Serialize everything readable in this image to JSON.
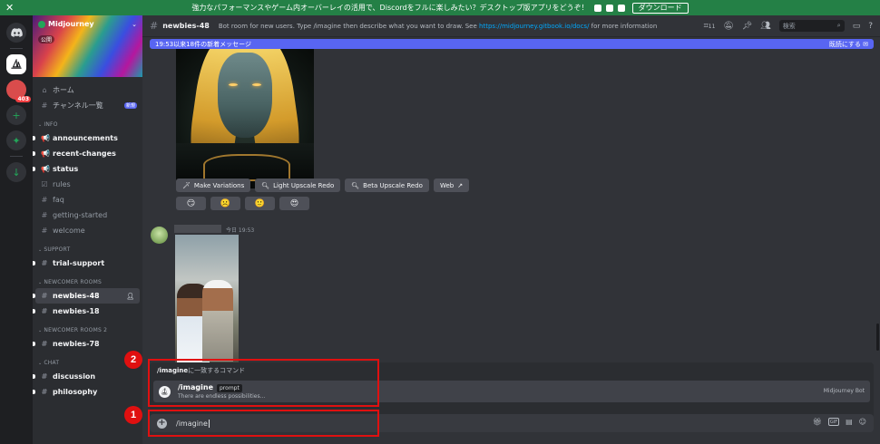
{
  "banner": {
    "text": "強力なパフォーマンスやゲーム内オーバーレイの活用で、Discordをフルに楽しみたい？デスクトップ版アプリをどうぞ！",
    "download_label": "ダウンロード",
    "close": "✕"
  },
  "servers": {
    "badge": "403",
    "add": "+",
    "discover": "✦",
    "download": "↓"
  },
  "server": {
    "name": "Midjourney",
    "public_label": "公開",
    "chevron": "⌄"
  },
  "channels": {
    "home": "ホーム",
    "browse": "チャンネル一覧",
    "new_tag": "新規",
    "categories": [
      {
        "name": "INFO",
        "items": [
          {
            "label": "announcements",
            "icon": "📢",
            "bold": true
          },
          {
            "label": "recent-changes",
            "icon": "📢",
            "bold": true
          },
          {
            "label": "status",
            "icon": "📢",
            "bold": true
          },
          {
            "label": "rules",
            "icon": "☑",
            "bold": false
          },
          {
            "label": "faq",
            "icon": "#",
            "bold": false
          },
          {
            "label": "getting-started",
            "icon": "#",
            "bold": false
          },
          {
            "label": "welcome",
            "icon": "#",
            "bold": false
          }
        ]
      },
      {
        "name": "SUPPORT",
        "items": [
          {
            "label": "trial-support",
            "icon": "#",
            "bold": true
          }
        ]
      },
      {
        "name": "NEWCOMER ROOMS",
        "items": [
          {
            "label": "newbies-48",
            "icon": "#",
            "bold": true,
            "active": true
          },
          {
            "label": "newbies-18",
            "icon": "#",
            "bold": true
          }
        ]
      },
      {
        "name": "NEWCOMER ROOMS 2",
        "items": [
          {
            "label": "newbies-78",
            "icon": "#",
            "bold": true
          }
        ]
      },
      {
        "name": "CHAT",
        "items": [
          {
            "label": "discussion",
            "icon": "#",
            "bold": true
          },
          {
            "label": "philosophy",
            "icon": "#",
            "bold": true
          }
        ]
      }
    ]
  },
  "topbar": {
    "channel": "newbies-48",
    "topic_prefix": "Bot room for new users. Type /imagine then describe what you want to draw. See ",
    "topic_link": "https://midjourney.gitbook.io/docs/",
    "topic_suffix": " for more information",
    "threads_count": "11",
    "search_placeholder": "検索"
  },
  "new_messages": {
    "text": "19:53以来18件の新着メッセージ",
    "mark_read": "既読にする"
  },
  "buttons": {
    "make_variations": "Make Variations",
    "light_upscale": "Light Upscale Redo",
    "beta_upscale": "Beta Upscale Redo",
    "web": "Web",
    "reactions": [
      "😏",
      "☹️",
      "🙂",
      "😍"
    ]
  },
  "message2": {
    "time": "今日 19:53"
  },
  "autocomplete": {
    "header_bold": "/imagine",
    "header_rest": "に一致するコマンド",
    "command": "/imagine",
    "param": "prompt",
    "description": "There are endless possibilities...",
    "source": "Midjourney Bot"
  },
  "input": {
    "value": "/imagine"
  },
  "annotations": {
    "step1": "1",
    "step2": "2",
    "color": "#e01010"
  }
}
